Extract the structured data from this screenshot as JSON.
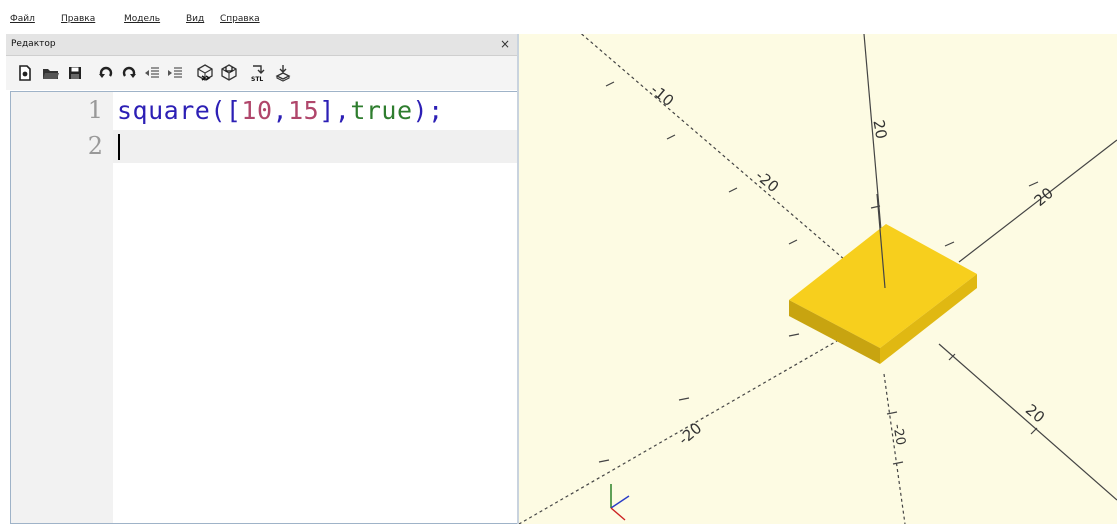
{
  "menu": {
    "items": [
      "Файл",
      "Правка",
      "Модель",
      "Вид",
      "Справка"
    ]
  },
  "editor": {
    "title": "Редактор",
    "close_label": "×",
    "toolbar": [
      {
        "name": "new-file-icon"
      },
      {
        "name": "open-file-icon"
      },
      {
        "name": "save-file-icon"
      },
      {
        "name": "undo-icon"
      },
      {
        "name": "redo-icon"
      },
      {
        "name": "unindent-icon"
      },
      {
        "name": "indent-icon"
      },
      {
        "name": "preview-icon"
      },
      {
        "name": "render-icon"
      },
      {
        "name": "export-stl-icon"
      },
      {
        "name": "send-to-print-icon"
      }
    ],
    "line_numbers": [
      "1",
      "2"
    ],
    "code": {
      "fn": "square",
      "open": "([",
      "n1": "10",
      "comma1": ",",
      "n2": "15",
      "close": "],",
      "kw": "true",
      "end": ");"
    },
    "colors": {
      "fn": "#2c1fb5",
      "number": "#b0466b",
      "keyword": "#2e7d2e",
      "punct": "#2c1fb5"
    }
  },
  "viewport": {
    "background": "#fdfbe3",
    "object_color": "#f7cf1d",
    "axis_labels": [
      "-10",
      "-20",
      "20",
      "-20",
      "20",
      "20",
      "-20"
    ]
  }
}
